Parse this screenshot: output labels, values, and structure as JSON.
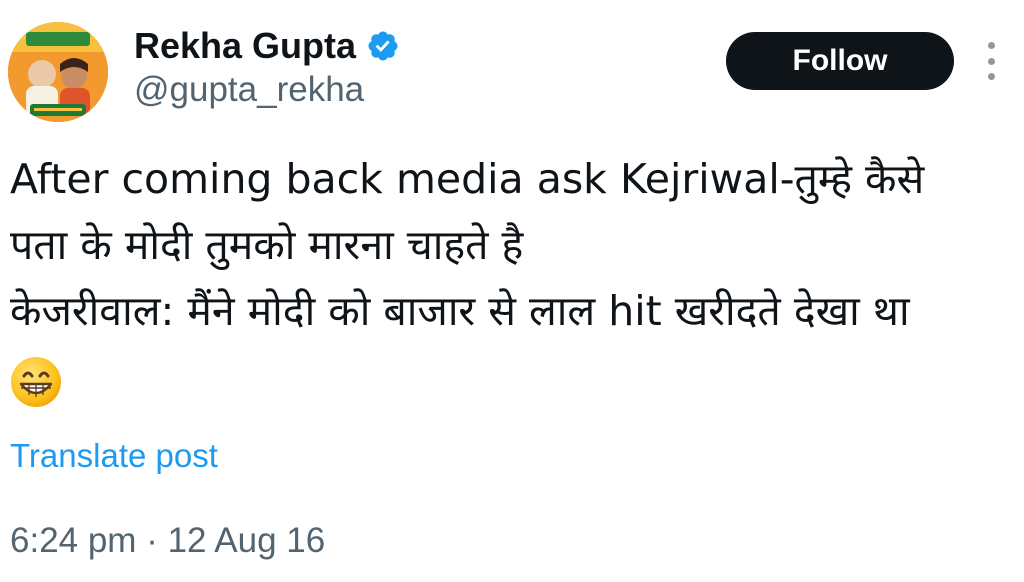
{
  "author": {
    "display_name": "Rekha Gupta",
    "handle": "@gupta_rekha",
    "avatar_icon": "profile-photo",
    "verified_icon": "verified-badge-icon",
    "verified_color": "#1d9bf0"
  },
  "actions": {
    "follow_label": "Follow",
    "more_icon": "more-options-icon"
  },
  "post": {
    "lines": [
      "After coming back media ask Kejriwal-तुम्हे कैसे",
      "पता के मोदी तुमको मारना चाहते है",
      "केजरीवाल: मैंने मोदी को बाजार से लाल hit खरीदते देखा था"
    ],
    "emoji": "grinning-face-icon"
  },
  "translate_label": "Translate post",
  "timestamp": "6:24 pm · 12 Aug 16",
  "colors": {
    "text": "#0f1419",
    "secondary": "#536471",
    "link": "#1d9bf0",
    "button_bg": "#0f1419"
  }
}
